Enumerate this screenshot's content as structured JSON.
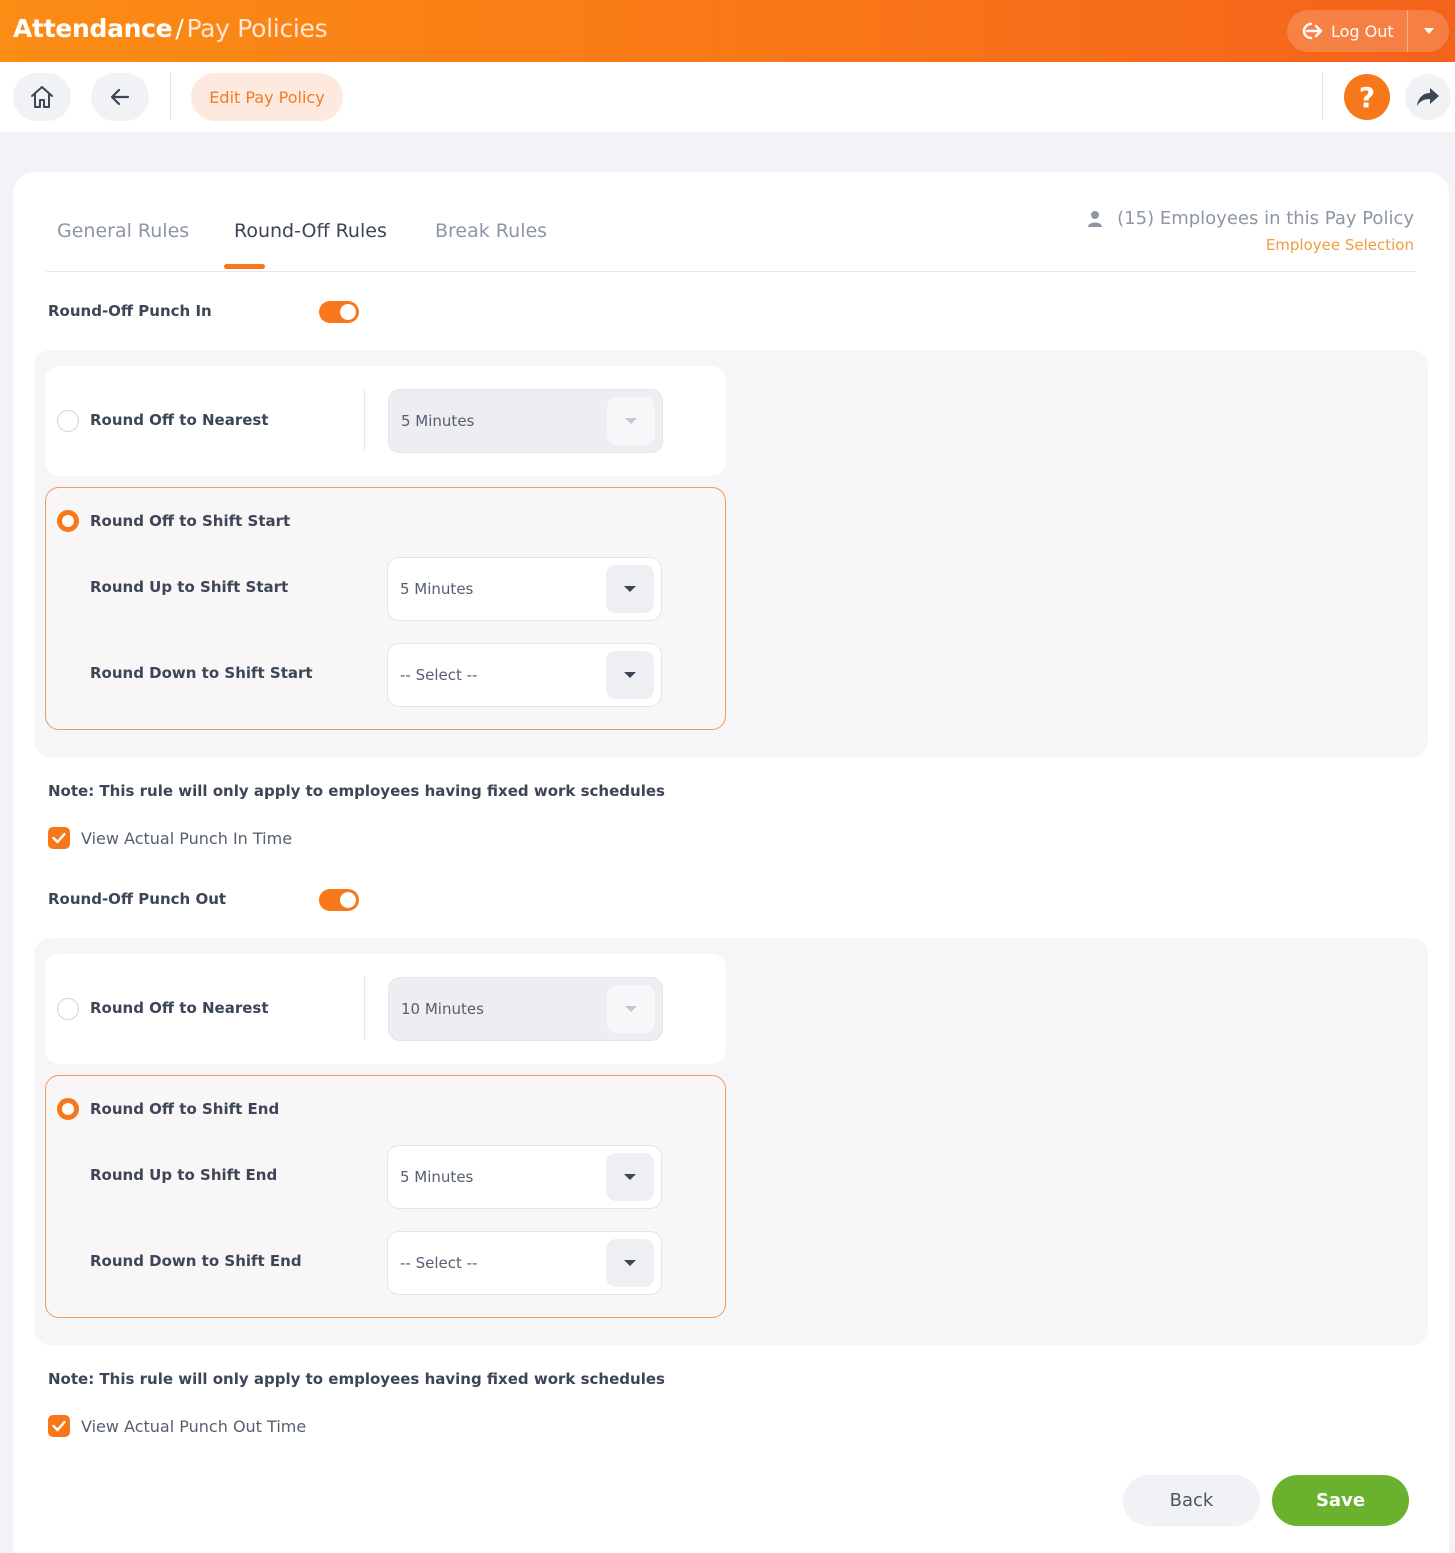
{
  "header": {
    "app_title": "Attendance",
    "separator": "/",
    "page_title": "Pay Policies",
    "logout_label": "Log Out",
    "brand_color": "#f7781a"
  },
  "toolbar": {
    "breadcrumb_label": "Edit Pay Policy",
    "help_label": "?"
  },
  "tabs": [
    {
      "label": "General Rules",
      "active": false
    },
    {
      "label": "Round-Off Rules",
      "active": true
    },
    {
      "label": "Break Rules",
      "active": false
    }
  ],
  "employees": {
    "count_text": "(15) Employees in this Pay Policy",
    "link": "Employee Selection"
  },
  "punch_in": {
    "toggle_label": "Round-Off Punch In",
    "enabled": true,
    "nearest": {
      "label": "Round Off to Nearest",
      "value": "5 Minutes",
      "selected": false
    },
    "shift": {
      "label": "Round Off to Shift Start",
      "selected": true,
      "round_up": {
        "label": "Round Up to Shift Start",
        "value": "5 Minutes"
      },
      "round_down": {
        "label": "Round Down to Shift Start",
        "value": "-- Select --"
      }
    },
    "note": "Note: This rule will only apply to employees having fixed work schedules",
    "view_actual": {
      "label": "View Actual Punch In Time",
      "checked": true
    }
  },
  "punch_out": {
    "toggle_label": "Round-Off Punch Out",
    "enabled": true,
    "nearest": {
      "label": "Round Off to Nearest",
      "value": "10 Minutes",
      "selected": false
    },
    "shift": {
      "label": "Round Off to Shift End",
      "selected": true,
      "round_up": {
        "label": "Round Up to Shift End",
        "value": "5 Minutes"
      },
      "round_down": {
        "label": "Round Down to Shift End",
        "value": "-- Select --"
      }
    },
    "note": "Note: This rule will only apply to employees having fixed work schedules",
    "view_actual": {
      "label": "View Actual Punch Out Time",
      "checked": true
    }
  },
  "actions": {
    "back_label": "Back",
    "save_label": "Save",
    "save_color": "#6ab22d"
  }
}
